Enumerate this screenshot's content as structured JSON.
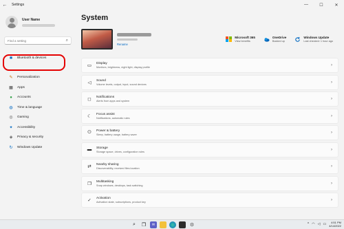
{
  "window": {
    "title": "Settings",
    "back_glyph": "←",
    "controls": [
      "—",
      "☐",
      "✕"
    ]
  },
  "profile": {
    "name": "User Name"
  },
  "search": {
    "placeholder": "Find a setting"
  },
  "sidebar": {
    "items": [
      {
        "label": "Bluetooth & devices",
        "icon": "bluetooth-icon",
        "glyph": "✱",
        "color": "#0067c0"
      },
      {
        "label": "Personalization",
        "icon": "brush-icon",
        "glyph": "✎",
        "color": "#c26a00"
      },
      {
        "label": "Apps",
        "icon": "apps-icon",
        "glyph": "▦",
        "color": "#3a3a3a"
      },
      {
        "label": "Accounts",
        "icon": "person-icon",
        "glyph": "●",
        "color": "#2f9e44"
      },
      {
        "label": "Time & language",
        "icon": "globe-icon",
        "glyph": "◍",
        "color": "#0067c0"
      },
      {
        "label": "Gaming",
        "icon": "gamepad-icon",
        "glyph": "◎",
        "color": "#555555"
      },
      {
        "label": "Accessibility",
        "icon": "accessibility-icon",
        "glyph": "✦",
        "color": "#0067c0"
      },
      {
        "label": "Privacy & security",
        "icon": "shield-icon",
        "glyph": "◈",
        "color": "#555555"
      },
      {
        "label": "Windows Update",
        "icon": "update-icon",
        "glyph": "↻",
        "color": "#0067c0"
      }
    ]
  },
  "main": {
    "title": "System",
    "device": {
      "rename": "Rename"
    },
    "tiles": [
      {
        "title": "Microsoft 365",
        "sub": "View benefits",
        "icon": "microsoft365-icon"
      },
      {
        "title": "OneDrive",
        "sub": "Backed up",
        "icon": "onedrive-icon"
      },
      {
        "title": "Windows Update",
        "sub": "Last checked: 1 hour ago",
        "icon": "windows-update-icon"
      }
    ],
    "cards": [
      {
        "title": "Display",
        "desc": "Monitors, brightness, night light, display profile",
        "icon": "display-icon",
        "glyph": "▭"
      },
      {
        "title": "Sound",
        "desc": "Volume levels, output, input, sound devices",
        "icon": "speaker-icon",
        "glyph": "◁)"
      },
      {
        "title": "Notifications",
        "desc": "Alerts from apps and system",
        "icon": "bell-icon",
        "glyph": "◻"
      },
      {
        "title": "Focus assist",
        "desc": "Notifications, automatic rules",
        "icon": "moon-icon",
        "glyph": "☾"
      },
      {
        "title": "Power & battery",
        "desc": "Sleep, battery usage, battery saver",
        "icon": "power-icon",
        "glyph": "⏻"
      },
      {
        "title": "Storage",
        "desc": "Storage space, drives, configuration rules",
        "icon": "storage-icon",
        "glyph": "▬"
      },
      {
        "title": "Nearby sharing",
        "desc": "Discoverability, received files location",
        "icon": "share-icon",
        "glyph": "⇄"
      },
      {
        "title": "Multitasking",
        "desc": "Snap windows, desktops, task switching",
        "icon": "multitask-icon",
        "glyph": "❐"
      },
      {
        "title": "Activation",
        "desc": "Activation state, subscriptions, product key",
        "icon": "activation-icon",
        "glyph": "✓"
      }
    ]
  },
  "taskbar": {
    "time": "4:51 PM",
    "date": "4/14/2022",
    "apps": [
      "start-icon",
      "search-icon",
      "taskview-icon",
      "chat-icon",
      "explorer-icon",
      "edge-icon",
      "store-icon",
      "settings-icon"
    ]
  }
}
